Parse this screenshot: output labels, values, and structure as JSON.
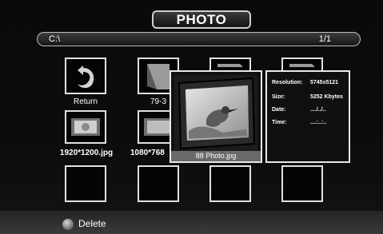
{
  "header": {
    "title": "PHOTO"
  },
  "path_bar": {
    "path": "C:\\",
    "page": "1/1"
  },
  "grid": {
    "return_label": "Return",
    "folder_label": "79-3",
    "file1": "1920*1200.jpg",
    "file2": "1080*768"
  },
  "preview": {
    "filename": "88 Photo.jpg"
  },
  "info": {
    "resolution_label": "Resolution:",
    "resolution_value": "5745x5121",
    "size_label": "Size:",
    "size_value": "5252 Kbytes",
    "date_label": "Date:",
    "date_value": "..../../..",
    "time_label": "Time:",
    "time_value": "....:..:.."
  },
  "footer": {
    "delete_label": "Delete"
  },
  "colors": {
    "background": "#0c0c0c",
    "frame": "#e0e0e0",
    "caption_bar": "#6a6a6a"
  }
}
